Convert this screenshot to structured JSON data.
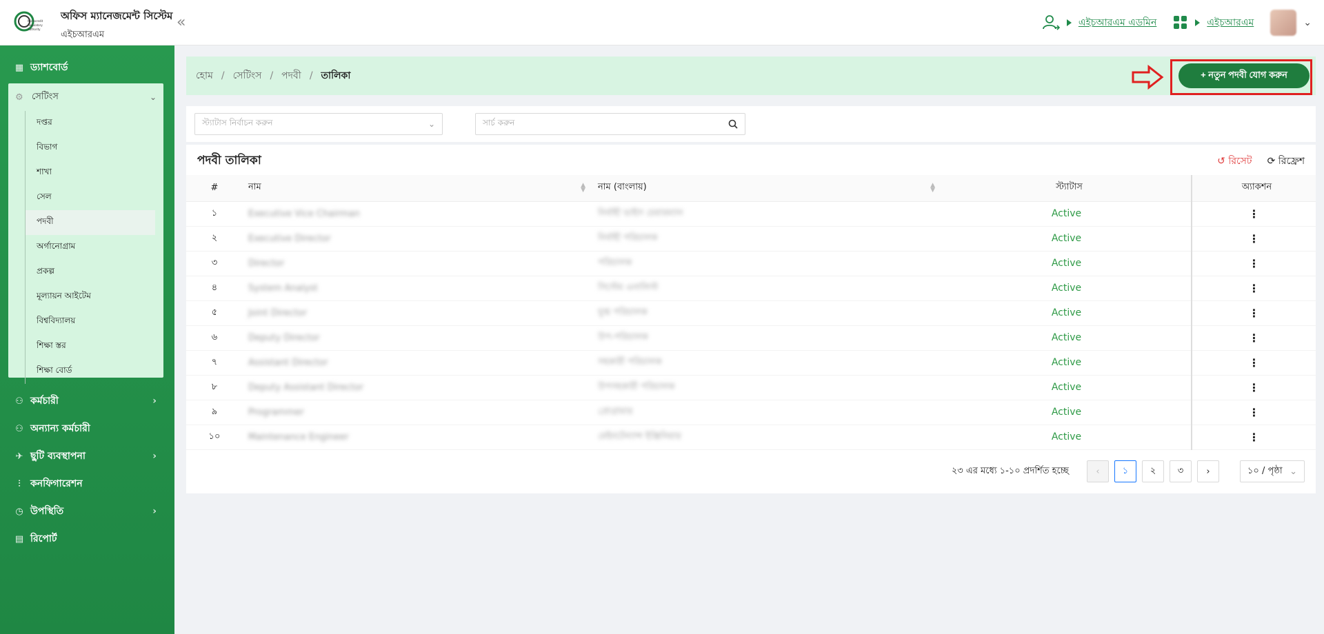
{
  "header": {
    "brand_title": "অফিস ম্যানেজমেন্ট সিস্টেম",
    "brand_sub": "এইচআরএম",
    "logo_text": "Microcredit Regulatory Authority",
    "collapse_icon": "double-chevron-left-icon",
    "user_link": "এইচআরএম এডমিন",
    "module_link": "এইচআরএম"
  },
  "sidebar": {
    "items_top": [
      {
        "label": "ড্যাশবোর্ড",
        "icon": "dashboard-icon"
      }
    ],
    "settings": {
      "label": "সেটিংস",
      "sub_items": [
        "দপ্তর",
        "বিভাগ",
        "শাখা",
        "সেল",
        "পদবী",
        "অর্গানোগ্রাম",
        "প্রকল্প",
        "মূল্যায়ন আইটেম",
        "বিশ্ববিদ্যালয়",
        "শিক্ষা স্তর",
        "শিক্ষা বোর্ড"
      ],
      "active": "পদবী"
    },
    "items_bottom": [
      {
        "label": "কর্মচারী",
        "icon": "users-icon",
        "has_arrow": true
      },
      {
        "label": "অন্যান্য কর্মচারী",
        "icon": "users-icon",
        "has_arrow": false
      },
      {
        "label": "ছুটি ব্যবস্থাপনা",
        "icon": "leave-icon",
        "has_arrow": true
      },
      {
        "label": "কনফিগারেশন",
        "icon": "sliders-icon",
        "has_arrow": false
      },
      {
        "label": "উপস্থিতি",
        "icon": "clock-icon",
        "has_arrow": true
      },
      {
        "label": "রিপোর্ট",
        "icon": "file-icon",
        "has_arrow": false
      }
    ]
  },
  "breadcrumb": {
    "home": "হোম",
    "settings": "সেটিংস",
    "designation": "পদবী",
    "current": "তালিকা"
  },
  "add_button": "+ নতুন পদবী যোগ করুন",
  "filters": {
    "status_placeholder": "স্ট্যাটাস নির্বাচন করুন",
    "search_placeholder": "সার্চ করুন"
  },
  "table": {
    "title": "পদবী তালিকা",
    "reset_label": "রিসেট",
    "refresh_label": "রিফ্রেশ",
    "columns": {
      "num": "#",
      "name": "নাম",
      "name_bn": "নাম (বাংলায়)",
      "status": "স্ট্যাটাস",
      "action": "অ্যাকশন"
    },
    "rows": [
      {
        "num": "১",
        "name": "Executive Vice Chairman",
        "name_bn": "নির্বাহী ভাইস চেয়ারম্যান",
        "status": "Active"
      },
      {
        "num": "২",
        "name": "Executive Director",
        "name_bn": "নির্বাহী পরিচালক",
        "status": "Active"
      },
      {
        "num": "৩",
        "name": "Director",
        "name_bn": "পরিচালক",
        "status": "Active"
      },
      {
        "num": "৪",
        "name": "System Analyst",
        "name_bn": "সিস্টেম এনালিস্ট",
        "status": "Active"
      },
      {
        "num": "৫",
        "name": "Joint Director",
        "name_bn": "যুগ্ম পরিচালক",
        "status": "Active"
      },
      {
        "num": "৬",
        "name": "Deputy Director",
        "name_bn": "উপ-পরিচালক",
        "status": "Active"
      },
      {
        "num": "৭",
        "name": "Assistant Director",
        "name_bn": "সহকারী পরিচালক",
        "status": "Active"
      },
      {
        "num": "৮",
        "name": "Deputy Assistant Director",
        "name_bn": "উপসহকারী পরিচালক",
        "status": "Active"
      },
      {
        "num": "৯",
        "name": "Programmer",
        "name_bn": "প্রোগ্রামার",
        "status": "Active"
      },
      {
        "num": "১০",
        "name": "Maintenance Engineer",
        "name_bn": "মেইনটেন্যান্স ইঞ্জিনিয়ার",
        "status": "Active"
      }
    ]
  },
  "pagination": {
    "info": "২৩ এর মধ্যে ১-১০ প্রদর্শিত হচ্ছে",
    "pages": [
      "১",
      "২",
      "৩"
    ],
    "current": "১",
    "page_size": "১০ / পৃষ্ঠা"
  },
  "colors": {
    "brand_green": "#1f8744",
    "status_green": "#2e9a46",
    "highlight_red": "#e02020"
  }
}
